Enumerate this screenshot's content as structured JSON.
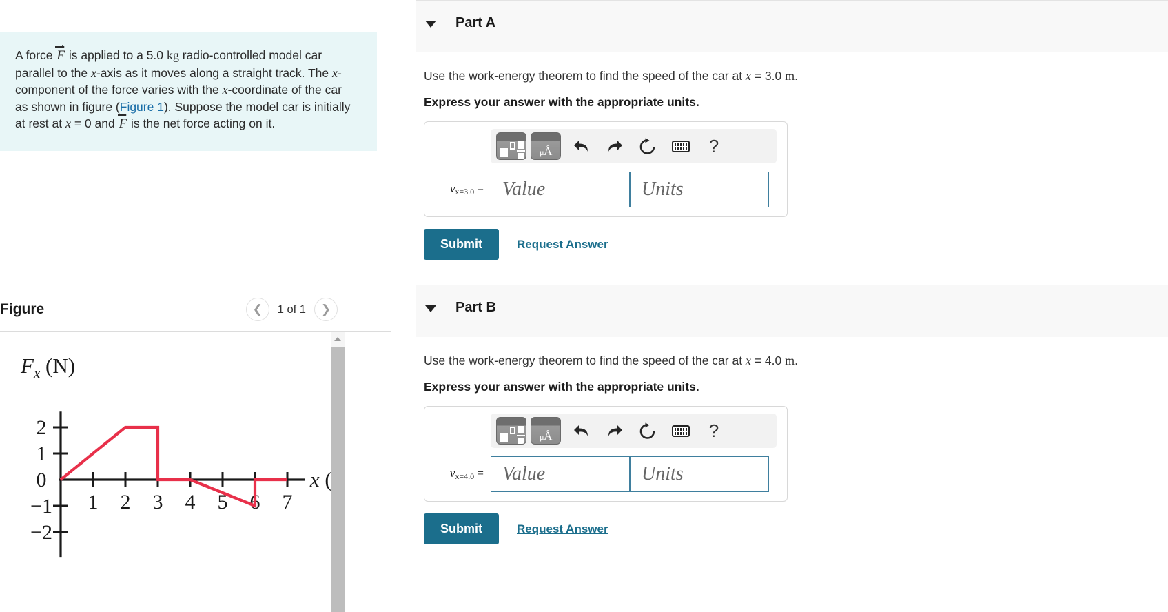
{
  "problem": {
    "segments": [
      {
        "t": "text",
        "v": "A force "
      },
      {
        "t": "vec",
        "v": "F"
      },
      {
        "t": "text",
        "v": " is applied to a 5.0 "
      },
      {
        "t": "mathr",
        "v": "kg"
      },
      {
        "t": "text",
        "v": " radio-controlled model car parallel to the "
      },
      {
        "t": "mathi",
        "v": "x"
      },
      {
        "t": "text",
        "v": "-axis as it moves along a straight track. The "
      },
      {
        "t": "mathi",
        "v": "x"
      },
      {
        "t": "text",
        "v": "-component of the force varies with the "
      },
      {
        "t": "mathi",
        "v": "x"
      },
      {
        "t": "text",
        "v": "-coordinate of the car as shown in figure ("
      },
      {
        "t": "link",
        "v": "Figure 1"
      },
      {
        "t": "text",
        "v": "). Suppose the model car is initially at rest at "
      },
      {
        "t": "mathi",
        "v": "x"
      },
      {
        "t": "text",
        "v": " = 0 and "
      },
      {
        "t": "vec",
        "v": "F"
      },
      {
        "t": "text",
        "v": " is the net force acting on it."
      }
    ],
    "figure_link_label": "Figure 1",
    "mass": "5.0 kg",
    "initial_position": "x = 0"
  },
  "figure": {
    "title": "Figure",
    "counter": "1 of 1",
    "prev_icon": "chevron-left-icon",
    "next_icon": "chevron-right-icon",
    "scroll_up_icon": "triangle-up-icon"
  },
  "chart_data": {
    "type": "line",
    "title": "",
    "xlabel": "x (m)",
    "ylabel": "F_x (N)",
    "xlim": [
      0,
      7.6
    ],
    "ylim": [
      -2.6,
      2.6
    ],
    "xticks": [
      1,
      2,
      3,
      4,
      5,
      6,
      7
    ],
    "yticks": [
      -2,
      -1,
      0,
      1,
      2
    ],
    "xtick_labels": [
      "1",
      "2",
      "3",
      "4",
      "5",
      "6",
      "7"
    ],
    "ytick_labels": [
      "−2",
      "−1",
      "0",
      "1",
      "2"
    ],
    "grid": false,
    "legend": false,
    "series": [
      {
        "name": "Fx",
        "color": "#e8304a",
        "points": [
          {
            "x": 0,
            "y": 0
          },
          {
            "x": 2,
            "y": 2
          },
          {
            "x": 3,
            "y": 2
          },
          {
            "x": 3,
            "y": 0
          },
          {
            "x": 4,
            "y": 0
          },
          {
            "x": 6,
            "y": -1
          },
          {
            "x": 6,
            "y": 0
          },
          {
            "x": 7,
            "y": 0
          }
        ]
      }
    ]
  },
  "parts": [
    {
      "id": "A",
      "caret_icon": "caret-down-icon",
      "label": "Part A",
      "question": "Use the work-energy theorem to find the speed of the car at ",
      "question_math_var": "x",
      "question_math_val": " = 3.0 ",
      "question_math_unit": "m",
      "question_tail": ".",
      "instruction": "Express your answer with the appropriate units.",
      "answer": {
        "symbol_v": "v",
        "symbol_sub": "x=3.0",
        "symbol_eq": " =",
        "value_placeholder": "Value",
        "units_placeholder": "Units",
        "value": "",
        "units": ""
      },
      "toolbar": {
        "template_icon": "math-template-icon",
        "units_icon": "units-micro-angstrom-icon",
        "units_text_mu": "μ",
        "units_text_a": "Å",
        "undo_icon": "undo-arrow-icon",
        "redo_icon": "redo-arrow-icon",
        "reset_icon": "reset-circular-arrow-icon",
        "keyboard_icon": "keyboard-icon",
        "help_icon": "question-mark-icon",
        "help_label": "?"
      },
      "submit_label": "Submit",
      "request_answer_label": "Request Answer"
    },
    {
      "id": "B",
      "caret_icon": "caret-down-icon",
      "label": "Part B",
      "question": "Use the work-energy theorem to find the speed of the car at ",
      "question_math_var": "x",
      "question_math_val": " = 4.0 ",
      "question_math_unit": "m",
      "question_tail": ".",
      "instruction": "Express your answer with the appropriate units.",
      "answer": {
        "symbol_v": "v",
        "symbol_sub": "x=4.0",
        "symbol_eq": " =",
        "value_placeholder": "Value",
        "units_placeholder": "Units",
        "value": "",
        "units": ""
      },
      "toolbar": {
        "template_icon": "math-template-icon",
        "units_icon": "units-micro-angstrom-icon",
        "units_text_mu": "μ",
        "units_text_a": "Å",
        "undo_icon": "undo-arrow-icon",
        "redo_icon": "redo-arrow-icon",
        "reset_icon": "reset-circular-arrow-icon",
        "keyboard_icon": "keyboard-icon",
        "help_icon": "question-mark-icon",
        "help_label": "?"
      },
      "submit_label": "Submit",
      "request_answer_label": "Request Answer"
    }
  ],
  "colors": {
    "accent": "#1b6e8c",
    "problem_bg": "#e8f6f7",
    "curve": "#e8304a",
    "panel_bg": "#f8f8f8"
  }
}
